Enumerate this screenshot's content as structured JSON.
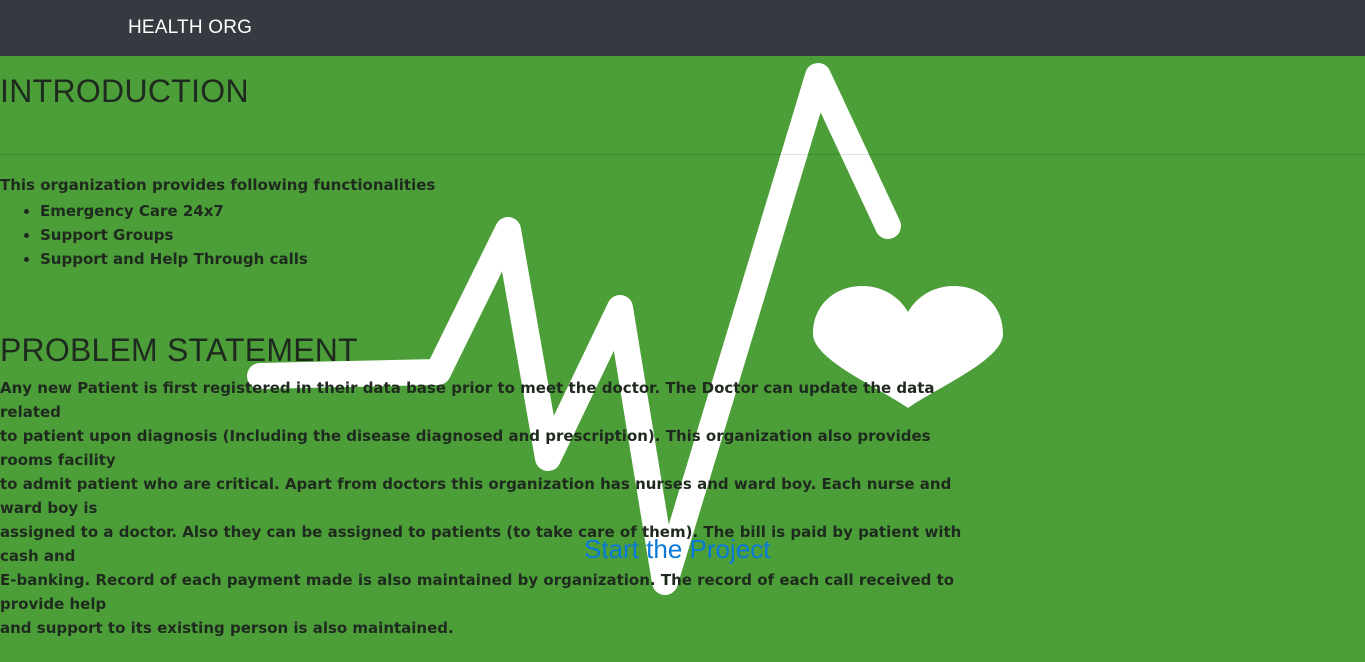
{
  "navbar": {
    "brand": "HEALTH ORG"
  },
  "intro": {
    "title": "INTRODUCTION",
    "lead": "This organization provides following functionalities",
    "features": [
      "Emergency Care 24x7",
      "Support Groups",
      "Support and Help Through calls"
    ]
  },
  "problem": {
    "title": "PROBLEM STATEMENT",
    "lines": [
      "Any new Patient is first registered in their data base prior to meet the doctor. The Doctor can update the data related",
      "to patient upon diagnosis (Including the disease diagnosed and prescription). This organization also provides rooms facility",
      "to admit patient who are critical. Apart from doctors this organization has nurses and ward boy. Each nurse and ward boy is",
      "assigned to a doctor. Also they can be assigned to patients (to take care of them). The bill is paid by patient with cash and",
      "E-banking. Record of each payment made is also maintained by organization. The record of each call received to provide help",
      "and support to its existing person is also maintained."
    ]
  },
  "cta": {
    "label": "Start the Project"
  },
  "icons": {
    "background": "heartbeat-heart-icon"
  },
  "colors": {
    "background": "#4c9f38",
    "navbar": "#343a40",
    "link": "#0a7ad8",
    "text": "#1f2a1f"
  }
}
